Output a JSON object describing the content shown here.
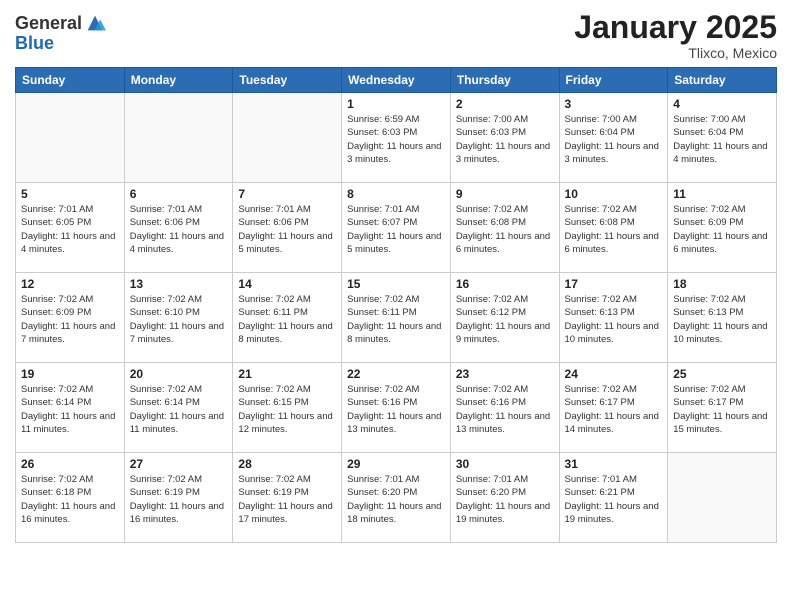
{
  "logo": {
    "general": "General",
    "blue": "Blue"
  },
  "header": {
    "month": "January 2025",
    "location": "Tlixco, Mexico"
  },
  "weekdays": [
    "Sunday",
    "Monday",
    "Tuesday",
    "Wednesday",
    "Thursday",
    "Friday",
    "Saturday"
  ],
  "weeks": [
    [
      {
        "day": "",
        "info": ""
      },
      {
        "day": "",
        "info": ""
      },
      {
        "day": "",
        "info": ""
      },
      {
        "day": "1",
        "info": "Sunrise: 6:59 AM\nSunset: 6:03 PM\nDaylight: 11 hours\nand 3 minutes."
      },
      {
        "day": "2",
        "info": "Sunrise: 7:00 AM\nSunset: 6:03 PM\nDaylight: 11 hours\nand 3 minutes."
      },
      {
        "day": "3",
        "info": "Sunrise: 7:00 AM\nSunset: 6:04 PM\nDaylight: 11 hours\nand 3 minutes."
      },
      {
        "day": "4",
        "info": "Sunrise: 7:00 AM\nSunset: 6:04 PM\nDaylight: 11 hours\nand 4 minutes."
      }
    ],
    [
      {
        "day": "5",
        "info": "Sunrise: 7:01 AM\nSunset: 6:05 PM\nDaylight: 11 hours\nand 4 minutes."
      },
      {
        "day": "6",
        "info": "Sunrise: 7:01 AM\nSunset: 6:06 PM\nDaylight: 11 hours\nand 4 minutes."
      },
      {
        "day": "7",
        "info": "Sunrise: 7:01 AM\nSunset: 6:06 PM\nDaylight: 11 hours\nand 5 minutes."
      },
      {
        "day": "8",
        "info": "Sunrise: 7:01 AM\nSunset: 6:07 PM\nDaylight: 11 hours\nand 5 minutes."
      },
      {
        "day": "9",
        "info": "Sunrise: 7:02 AM\nSunset: 6:08 PM\nDaylight: 11 hours\nand 6 minutes."
      },
      {
        "day": "10",
        "info": "Sunrise: 7:02 AM\nSunset: 6:08 PM\nDaylight: 11 hours\nand 6 minutes."
      },
      {
        "day": "11",
        "info": "Sunrise: 7:02 AM\nSunset: 6:09 PM\nDaylight: 11 hours\nand 6 minutes."
      }
    ],
    [
      {
        "day": "12",
        "info": "Sunrise: 7:02 AM\nSunset: 6:09 PM\nDaylight: 11 hours\nand 7 minutes."
      },
      {
        "day": "13",
        "info": "Sunrise: 7:02 AM\nSunset: 6:10 PM\nDaylight: 11 hours\nand 7 minutes."
      },
      {
        "day": "14",
        "info": "Sunrise: 7:02 AM\nSunset: 6:11 PM\nDaylight: 11 hours\nand 8 minutes."
      },
      {
        "day": "15",
        "info": "Sunrise: 7:02 AM\nSunset: 6:11 PM\nDaylight: 11 hours\nand 8 minutes."
      },
      {
        "day": "16",
        "info": "Sunrise: 7:02 AM\nSunset: 6:12 PM\nDaylight: 11 hours\nand 9 minutes."
      },
      {
        "day": "17",
        "info": "Sunrise: 7:02 AM\nSunset: 6:13 PM\nDaylight: 11 hours\nand 10 minutes."
      },
      {
        "day": "18",
        "info": "Sunrise: 7:02 AM\nSunset: 6:13 PM\nDaylight: 11 hours\nand 10 minutes."
      }
    ],
    [
      {
        "day": "19",
        "info": "Sunrise: 7:02 AM\nSunset: 6:14 PM\nDaylight: 11 hours\nand 11 minutes."
      },
      {
        "day": "20",
        "info": "Sunrise: 7:02 AM\nSunset: 6:14 PM\nDaylight: 11 hours\nand 11 minutes."
      },
      {
        "day": "21",
        "info": "Sunrise: 7:02 AM\nSunset: 6:15 PM\nDaylight: 11 hours\nand 12 minutes."
      },
      {
        "day": "22",
        "info": "Sunrise: 7:02 AM\nSunset: 6:16 PM\nDaylight: 11 hours\nand 13 minutes."
      },
      {
        "day": "23",
        "info": "Sunrise: 7:02 AM\nSunset: 6:16 PM\nDaylight: 11 hours\nand 13 minutes."
      },
      {
        "day": "24",
        "info": "Sunrise: 7:02 AM\nSunset: 6:17 PM\nDaylight: 11 hours\nand 14 minutes."
      },
      {
        "day": "25",
        "info": "Sunrise: 7:02 AM\nSunset: 6:17 PM\nDaylight: 11 hours\nand 15 minutes."
      }
    ],
    [
      {
        "day": "26",
        "info": "Sunrise: 7:02 AM\nSunset: 6:18 PM\nDaylight: 11 hours\nand 16 minutes."
      },
      {
        "day": "27",
        "info": "Sunrise: 7:02 AM\nSunset: 6:19 PM\nDaylight: 11 hours\nand 16 minutes."
      },
      {
        "day": "28",
        "info": "Sunrise: 7:02 AM\nSunset: 6:19 PM\nDaylight: 11 hours\nand 17 minutes."
      },
      {
        "day": "29",
        "info": "Sunrise: 7:01 AM\nSunset: 6:20 PM\nDaylight: 11 hours\nand 18 minutes."
      },
      {
        "day": "30",
        "info": "Sunrise: 7:01 AM\nSunset: 6:20 PM\nDaylight: 11 hours\nand 19 minutes."
      },
      {
        "day": "31",
        "info": "Sunrise: 7:01 AM\nSunset: 6:21 PM\nDaylight: 11 hours\nand 19 minutes."
      },
      {
        "day": "",
        "info": ""
      }
    ]
  ]
}
